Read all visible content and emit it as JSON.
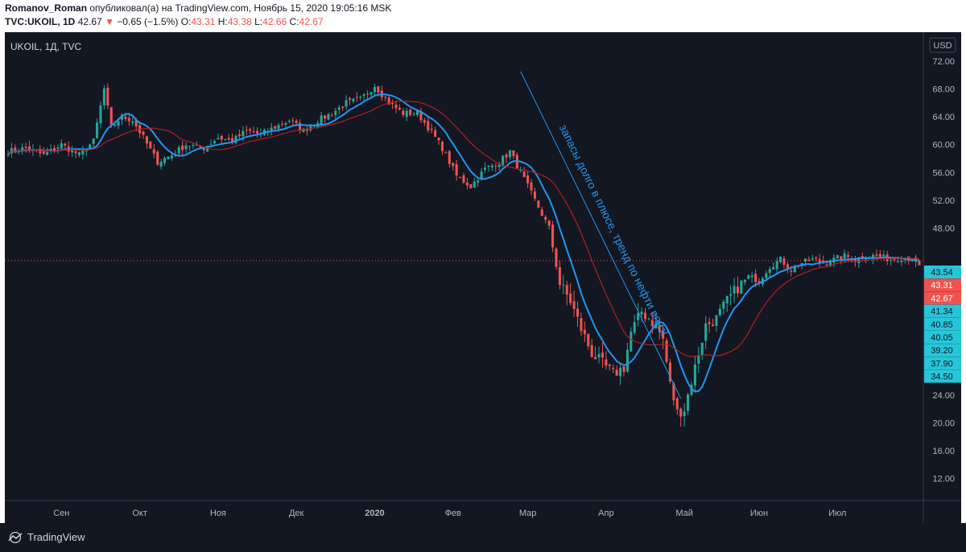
{
  "header": {
    "author": "Romanov_Roman",
    "published_text": "опубликовал(а) на TradingView.com, Ноябрь 15, 2020 19:05:16 MSK",
    "symbol": "TVC:UKOIL, 1D",
    "last": "42.67",
    "arrow": "▼",
    "change": "−0.65 (−1.5%)",
    "o_label": "O:",
    "o_value": "43.31",
    "h_label": "H:",
    "h_value": "43.38",
    "l_label": "L:",
    "l_value": "42.66",
    "c_label": "C:",
    "c_value": "42.67"
  },
  "brand": {
    "name": "TradingView"
  },
  "colors": {
    "up": "#26a69a",
    "down": "#ef5350",
    "ma_fast": "#2196f3",
    "ma_slow": "#b71c1c",
    "axis_text": "#b2b5be",
    "price_tag": "#26c6da",
    "bg": "#131722"
  },
  "chart_data": {
    "type": "candlestick",
    "symbol_label": "UKOIL, 1Д, TVC",
    "currency": "USD",
    "ylim": [
      10,
      75
    ],
    "y_ticks": [
      "72.00",
      "68.00",
      "64.00",
      "60.00",
      "56.00",
      "52.00",
      "48.00",
      "24.00",
      "20.00",
      "16.00",
      "12.00"
    ],
    "x_ticks": [
      {
        "label": "Сен",
        "day": 15
      },
      {
        "label": "Окт",
        "day": 37
      },
      {
        "label": "Ноя",
        "day": 59
      },
      {
        "label": "Дек",
        "day": 81
      },
      {
        "label": "2020",
        "day": 103
      },
      {
        "label": "Фев",
        "day": 125
      },
      {
        "label": "Мар",
        "day": 146
      },
      {
        "label": "Апр",
        "day": 168
      },
      {
        "label": "Май",
        "day": 190
      },
      {
        "label": "Июн",
        "day": 211
      },
      {
        "label": "Июл",
        "day": 233
      }
    ],
    "n_days": 257,
    "anchors": [
      [
        0,
        59.0
      ],
      [
        5,
        59.5
      ],
      [
        10,
        58.5
      ],
      [
        15,
        60.0
      ],
      [
        20,
        58.5
      ],
      [
        24,
        60.5
      ],
      [
        27,
        68.0
      ],
      [
        29,
        62.5
      ],
      [
        32,
        64.0
      ],
      [
        35,
        63.5
      ],
      [
        38,
        61.0
      ],
      [
        42,
        57.5
      ],
      [
        46,
        58.5
      ],
      [
        50,
        60.0
      ],
      [
        55,
        59.5
      ],
      [
        59,
        61.0
      ],
      [
        63,
        60.5
      ],
      [
        67,
        62.0
      ],
      [
        71,
        61.5
      ],
      [
        75,
        62.5
      ],
      [
        79,
        63.5
      ],
      [
        83,
        62.0
      ],
      [
        87,
        63.5
      ],
      [
        91,
        64.5
      ],
      [
        95,
        66.0
      ],
      [
        99,
        66.5
      ],
      [
        103,
        68.5
      ],
      [
        107,
        66.0
      ],
      [
        111,
        64.5
      ],
      [
        115,
        64.5
      ],
      [
        118,
        62.5
      ],
      [
        122,
        59.5
      ],
      [
        126,
        55.5
      ],
      [
        130,
        54.0
      ],
      [
        134,
        56.5
      ],
      [
        138,
        57.5
      ],
      [
        141,
        59.0
      ],
      [
        143,
        57.0
      ],
      [
        146,
        54.0
      ],
      [
        149,
        51.0
      ],
      [
        152,
        48.0
      ],
      [
        155,
        40.0
      ],
      [
        158,
        37.5
      ],
      [
        161,
        33.5
      ],
      [
        164,
        30.0
      ],
      [
        167,
        28.5
      ],
      [
        170,
        27.0
      ],
      [
        173,
        28.0
      ],
      [
        175,
        33.0
      ],
      [
        178,
        36.0
      ],
      [
        180,
        35.0
      ],
      [
        182,
        34.0
      ],
      [
        184,
        32.0
      ],
      [
        186,
        25.5
      ],
      [
        188,
        21.5
      ],
      [
        190,
        22.0
      ],
      [
        192,
        26.0
      ],
      [
        194,
        30.0
      ],
      [
        196,
        34.0
      ],
      [
        199,
        35.0
      ],
      [
        202,
        37.5
      ],
      [
        205,
        39.5
      ],
      [
        208,
        41.0
      ],
      [
        211,
        40.5
      ],
      [
        214,
        42.5
      ],
      [
        217,
        43.5
      ],
      [
        220,
        42.0
      ],
      [
        223,
        43.0
      ],
      [
        226,
        43.5
      ],
      [
        229,
        43.0
      ],
      [
        232,
        43.5
      ],
      [
        235,
        44.0
      ],
      [
        238,
        43.5
      ],
      [
        241,
        44.0
      ],
      [
        244,
        44.0
      ],
      [
        248,
        43.5
      ],
      [
        252,
        43.8
      ],
      [
        256,
        43.31
      ]
    ],
    "labelled_candles": {
      "ohlc_last": {
        "open": 43.31,
        "high": 43.38,
        "low": 42.66,
        "close": 42.67
      }
    },
    "moving_averages": [
      {
        "period": 9,
        "color": "#2196f3"
      },
      {
        "period": 21,
        "color": "#b71c1c"
      }
    ],
    "price_line": 43.31,
    "price_labels": [
      {
        "value": "43.54",
        "kind": "cyan"
      },
      {
        "value": "43.31",
        "kind": "red"
      },
      {
        "value": "42.67",
        "kind": "red"
      },
      {
        "value": "41.34",
        "kind": "cyan"
      },
      {
        "value": "40.85",
        "kind": "cyan"
      },
      {
        "value": "40.05",
        "kind": "cyan"
      },
      {
        "value": "39.20",
        "kind": "cyan"
      },
      {
        "value": "37.90",
        "kind": "cyan"
      },
      {
        "value": "34.50",
        "kind": "cyan"
      }
    ],
    "annotation": {
      "text": "запасы долго в плюсе, тренд по нефти вниз!",
      "line_start": {
        "day": 144,
        "price": 70.5
      },
      "line_end": {
        "day": 189,
        "price": 23.5
      }
    }
  }
}
